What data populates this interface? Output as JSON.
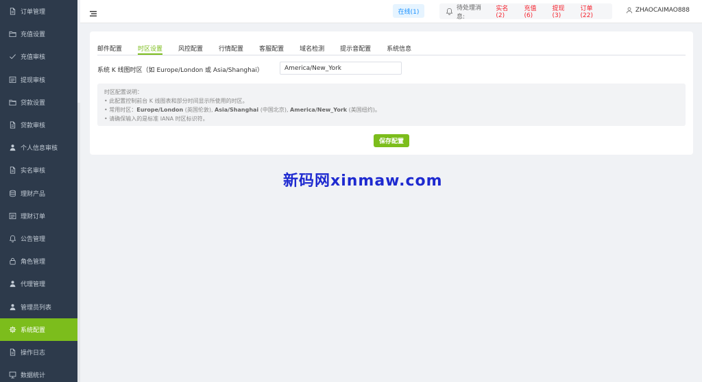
{
  "sidebar": {
    "items": [
      {
        "label": "订单管理",
        "icon": "document-icon"
      },
      {
        "label": "充值设置",
        "icon": "folder-icon"
      },
      {
        "label": "充值审核",
        "icon": "check-icon"
      },
      {
        "label": "提现审核",
        "icon": "list-icon"
      },
      {
        "label": "贷款设置",
        "icon": "folder-icon"
      },
      {
        "label": "贷款审核",
        "icon": "document-icon"
      },
      {
        "label": "个人信息审核",
        "icon": "user-icon"
      },
      {
        "label": "实名审核",
        "icon": "document-icon"
      },
      {
        "label": "理财产品",
        "icon": "database-icon"
      },
      {
        "label": "理财订单",
        "icon": "list-icon"
      },
      {
        "label": "公告管理",
        "icon": "bell-icon"
      },
      {
        "label": "角色管理",
        "icon": "lock-icon"
      },
      {
        "label": "代理管理",
        "icon": "user-icon"
      },
      {
        "label": "管理员列表",
        "icon": "user-icon"
      },
      {
        "label": "系统配置",
        "icon": "gear-icon",
        "active": true
      },
      {
        "label": "操作日志",
        "icon": "document-icon"
      },
      {
        "label": "数据统计",
        "icon": "chart-icon"
      }
    ]
  },
  "header": {
    "online": "在线(1)",
    "pending_label": "待处理消息:",
    "pending_links": [
      "实名(2)",
      "充值(6)",
      "提现(3)",
      "订单(22)"
    ],
    "username": "ZHAOCAIMAO888"
  },
  "tabs": [
    "邮件配置",
    "时区设置",
    "风控配置",
    "行情配置",
    "客服配置",
    "域名检测",
    "提示音配置",
    "系统信息"
  ],
  "active_tab": 1,
  "form": {
    "label": "系统 K 线图时区（如 Europe/London 或 Asia/Shanghai）",
    "value": "America/New_York"
  },
  "info": {
    "title": "时区配置说明：",
    "line1": "• 此配置控制前台 K 线图表和部分时间显示所使用的时区。",
    "line2_prefix": "• 常用时区：",
    "tz1": "Europe/London",
    "tz1_desc": " (英国伦敦), ",
    "tz2": "Asia/Shanghai",
    "tz2_desc": " (中国北京), ",
    "tz3": "America/New_York",
    "tz3_desc": " (美国纽约)。",
    "line3": "• 请确保输入的是标准 IANA 时区标识符。"
  },
  "save_label": "保存配置",
  "watermark": "新码网xinmaw.com",
  "colors": {
    "accent": "#7cbd1c",
    "sidebar_bg": "#2d3a4b",
    "alert": "#f5222d",
    "online": "#1890ff"
  }
}
